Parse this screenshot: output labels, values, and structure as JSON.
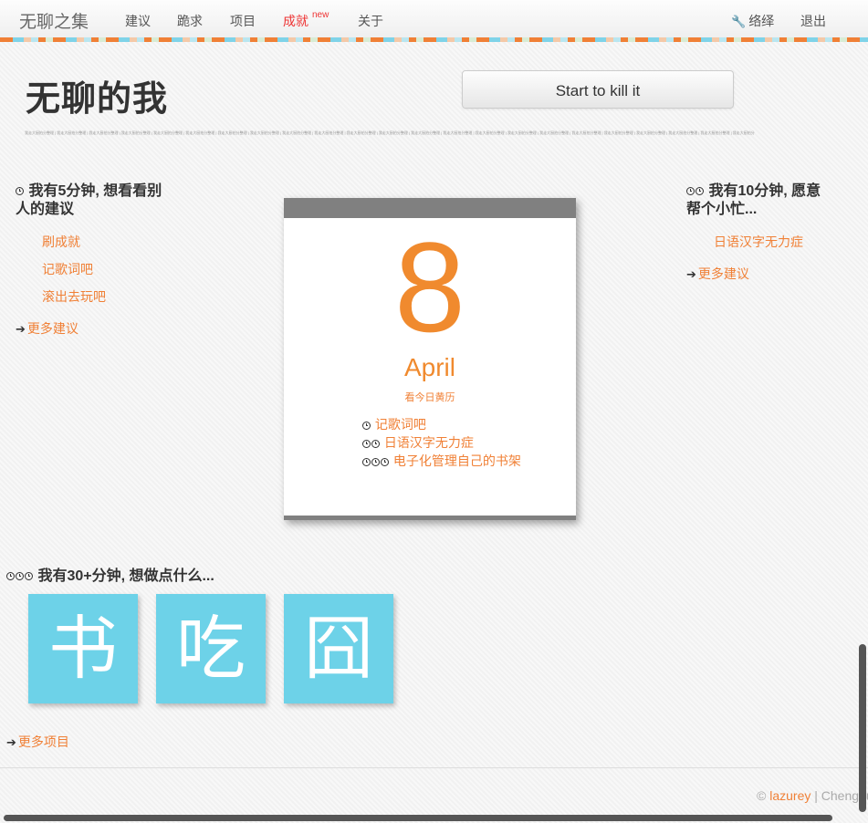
{
  "nav": {
    "brand": "无聊之集",
    "links": [
      "建议",
      "跪求",
      "项目",
      "成就",
      "关于"
    ],
    "new_badge": "new",
    "right": {
      "user": "络绎",
      "logout": "退出"
    }
  },
  "hero": {
    "title": "无聊的我",
    "button": "Start to kill it",
    "micro_text": "我走大厨拍分整理 | 我走大厨拍分整理 | 我走大厨拍分整理 | 我走大厨拍分整理 | 我走大厨拍分整理 | 我走大厨拍分整理 | 我走大厨拍分整理 | 我走大厨拍分整理 | 我走大厨拍分整理 | 我走大厨拍分整理 | 我走大厨拍分整理 | 我走大厨拍分整理 | 我走大厨拍分整理 | 我走大厨拍分整理 | 我走大厨拍分整理 | 我走大厨拍分整理 | 我走大厨拍分整理 | 我走大厨拍分整理 | 我走大厨拍分整理 | 我走大厨拍分整理 | 我走大厨拍分整理 | 我走大厨拍分整理 | 我走大厨拍分整理 | 我走大厨拍分整理"
  },
  "five_min": {
    "title_line1": "我有5分钟, 想看看别",
    "title_line2": "人的建议",
    "items": [
      "刷成就",
      "记歌词吧",
      "滚出去玩吧"
    ],
    "more": "更多建议"
  },
  "ten_min": {
    "title_line1": "我有10分钟, 愿意",
    "title_line2": "帮个小忙...",
    "items": [
      "日语汉字无力症"
    ],
    "more": "更多建议"
  },
  "calendar": {
    "day": "8",
    "month": "April",
    "link": "看今日黄历",
    "items": [
      {
        "text": "记歌词吧",
        "clocks": 1
      },
      {
        "text": "日语汉字无力症",
        "clocks": 2
      },
      {
        "text": "电子化管理自己的书架",
        "clocks": 3
      }
    ]
  },
  "thirty_min": {
    "title": "我有30+分钟, 想做点什么...",
    "tiles": [
      "书",
      "吃",
      "囧"
    ],
    "more": "更多项目"
  },
  "footer": {
    "copyright": "©",
    "author": "lazurey",
    "separator": "|",
    "location": "Chengdu"
  },
  "colors": {
    "accent": "#f08036",
    "tile": "#6dd2e8",
    "calendar_bar": "#808080"
  }
}
